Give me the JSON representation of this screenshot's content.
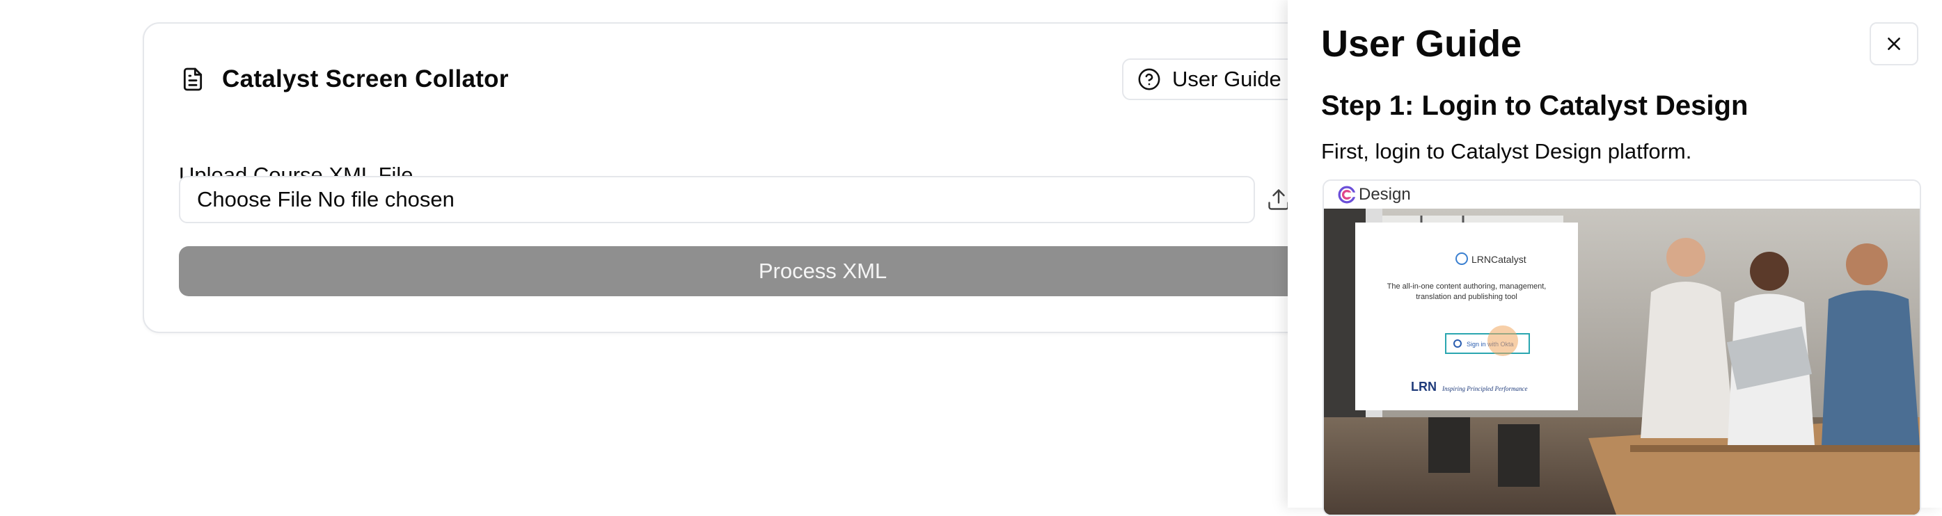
{
  "app": {
    "title": "Catalyst Screen Collator",
    "guide_button_label": "User Guide",
    "upload_label": "Upload Course XML File",
    "file_input": {
      "button_label": "Choose File",
      "status_text": "No file chosen"
    },
    "process_button_label": "Process XML"
  },
  "guide_panel": {
    "title": "User Guide",
    "steps": [
      {
        "title": "Step 1: Login to Catalyst Design",
        "description": "First, login to Catalyst Design platform.",
        "screenshot": {
          "app_bar_label": "Design",
          "brand_text": "LRNCatalyst",
          "tagline_line1": "The all-in-one content authoring, management,",
          "tagline_line2": "translation and publishing tool",
          "sign_in_label": "Sign in with Okta",
          "footer_brand": "LRN",
          "footer_slogan": "Inspiring Principled Performance"
        }
      }
    ]
  },
  "icons": {
    "document": "document-icon",
    "help": "help-circle-icon",
    "upload": "upload-icon",
    "close": "close-icon"
  },
  "colors": {
    "process_button_bg": "#8f8f8f",
    "border": "#e5e7eb",
    "text": "#0a0a0a"
  }
}
